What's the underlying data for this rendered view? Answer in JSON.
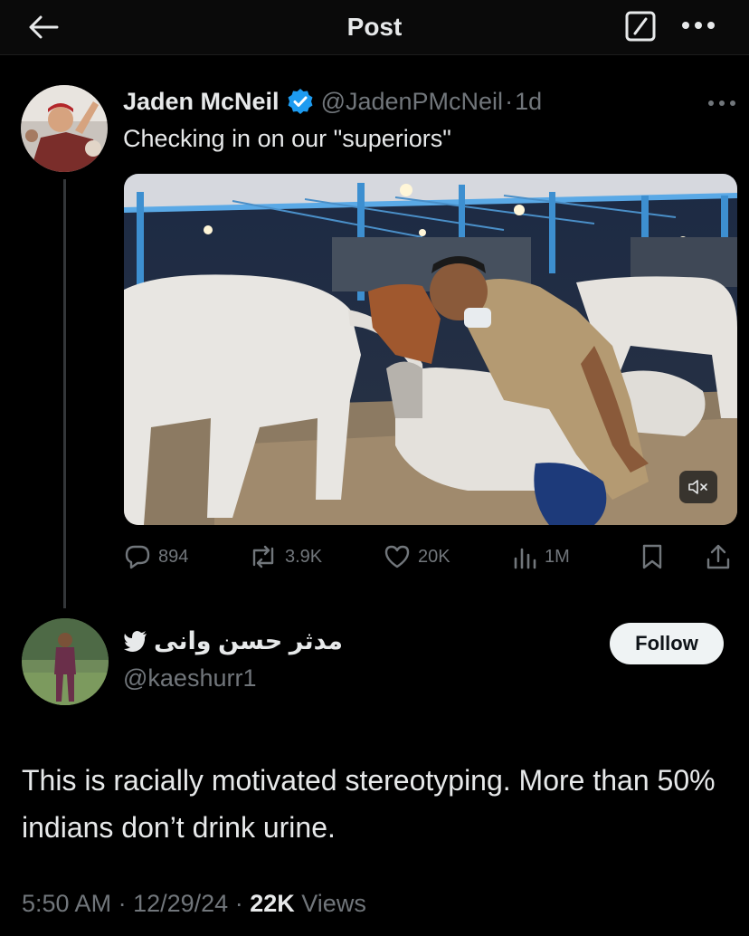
{
  "header": {
    "title": "Post"
  },
  "post": {
    "author_name": "Jaden McNeil",
    "handle": "@JadenPMcNeil",
    "separator": "·",
    "time": "1d",
    "text": "Checking in on our \"superiors\"",
    "stats": {
      "replies": "894",
      "reposts": "3.9K",
      "likes": "20K",
      "views": "1M"
    }
  },
  "reply": {
    "author_name": "مدثر حسن وانی",
    "handle": "@kaeshurr1",
    "follow_label": "Follow",
    "text": "This is racially motivated stereotyping. More than 50% indians don’t drink urine.",
    "time": "5:50 AM",
    "date": "12/29/24",
    "separator": "·",
    "views_count": "22K",
    "views_label": "Views"
  },
  "colors": {
    "background": "#000000",
    "text_primary": "#e7e9ea",
    "text_secondary": "#71767b",
    "verified": "#1d9bf0"
  }
}
